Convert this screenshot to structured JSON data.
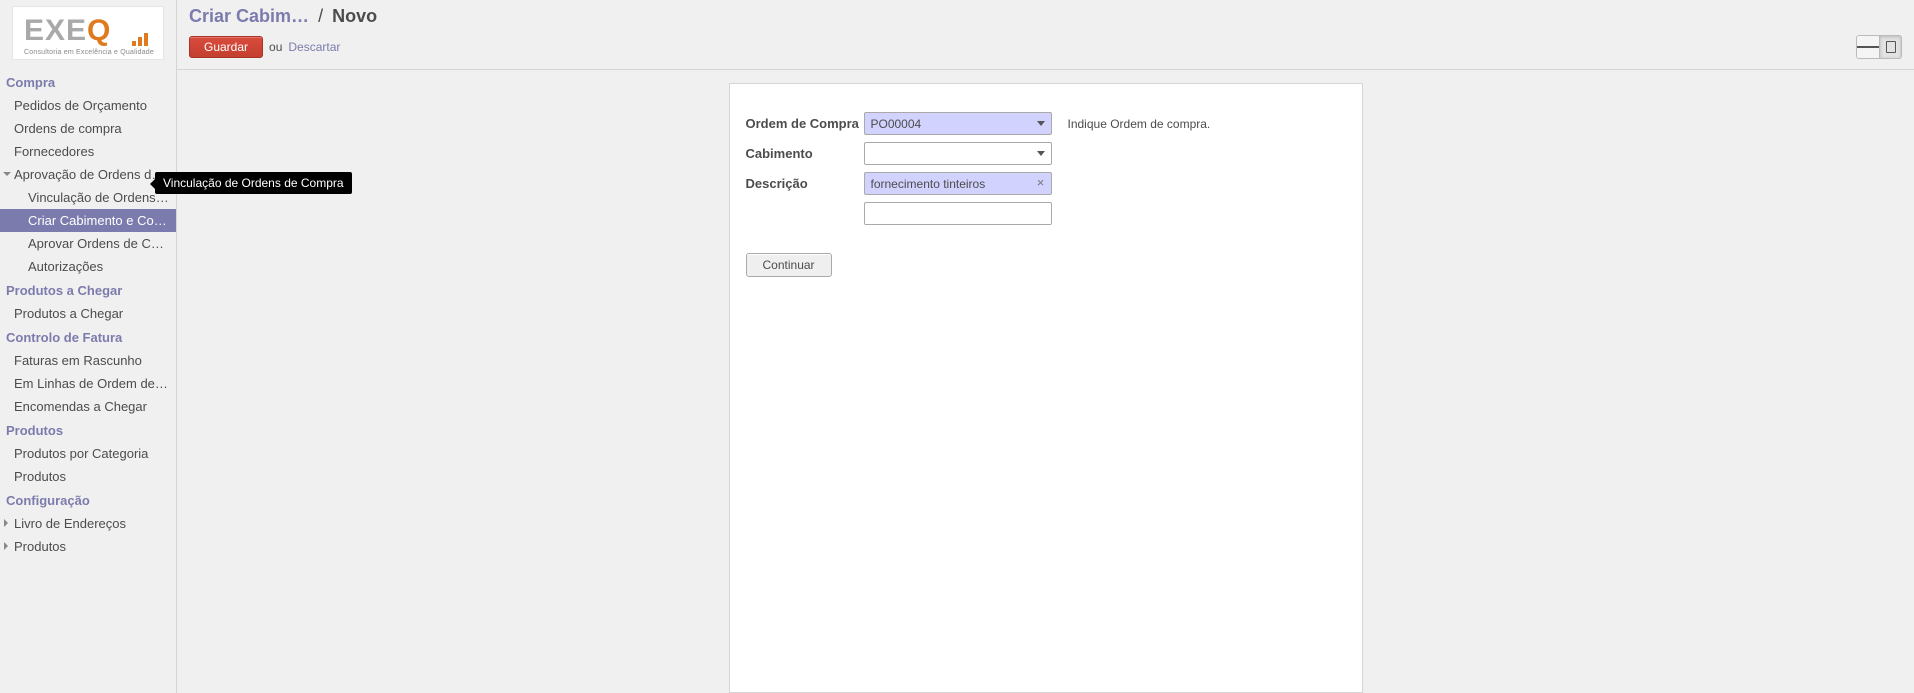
{
  "logo": {
    "text": "EXEQ",
    "tagline": "Consultoria em Excelência e Qualidade"
  },
  "sidebar": {
    "compra": {
      "title": "Compra",
      "pedidos": "Pedidos de Orçamento",
      "ordens": "Ordens de compra",
      "fornecedores": "Fornecedores",
      "aprovacao": "Aprovação de Ordens de Co…",
      "vinculacao": "Vinculação de Ordens de…",
      "criar_cab": "Criar Cabimento e Compr…",
      "aprovar": "Aprovar Ordens de Compra",
      "autorizacoes": "Autorizações"
    },
    "produtos_chegar": {
      "title": "Produtos a Chegar",
      "item": "Produtos a Chegar"
    },
    "controlo": {
      "title": "Controlo de Fatura",
      "rascunho": "Faturas em Rascunho",
      "linhas": "Em Linhas de Ordem de Co…",
      "encomendas": "Encomendas a Chegar"
    },
    "produtos": {
      "title": "Produtos",
      "por_cat": "Produtos por Categoria",
      "produtos": "Produtos"
    },
    "config": {
      "title": "Configuração",
      "livro": "Livro de Endereços",
      "produtos": "Produtos"
    }
  },
  "tooltip": "Vinculação de Ordens de Compra",
  "header": {
    "bc_link": "Criar Cabim…",
    "bc_current": "Novo",
    "save": "Guardar",
    "or": "ou",
    "discard": "Descartar"
  },
  "form": {
    "labels": {
      "ordem": "Ordem de Compra",
      "cabimento": "Cabimento",
      "descricao": "Descrição"
    },
    "values": {
      "ordem": "PO00004",
      "cabimento": "",
      "descricao": "fornecimento tinteiros",
      "extra": ""
    },
    "hint": "Indique Ordem de compra.",
    "continue": "Continuar"
  }
}
